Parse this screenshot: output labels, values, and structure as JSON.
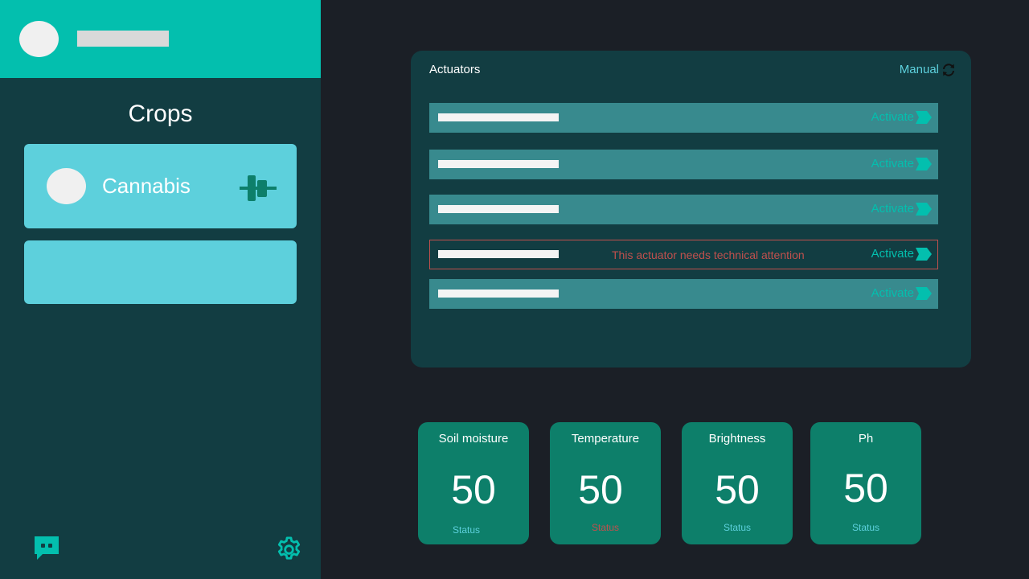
{
  "sidebar": {
    "title": "Crops",
    "crops": [
      {
        "name": "Cannabis",
        "icon": "plant-sensor-icon"
      }
    ],
    "footer": {
      "chat_icon": "chat-icon",
      "settings_icon": "gear-icon"
    }
  },
  "actuators": {
    "title": "Actuators",
    "mode_label": "Manual",
    "mode_icon": "sync-icon",
    "activate_label": "Activate",
    "alert_message": "This actuator needs technical attention",
    "alert_row_index": 4,
    "row_count": 5
  },
  "sensors": [
    {
      "name": "Soil moisture",
      "value": "50",
      "status": "Status",
      "status_state": "normal"
    },
    {
      "name": "Temperature",
      "value": "50",
      "status": "Status",
      "status_state": "warning"
    },
    {
      "name": "Brightness",
      "value": "50",
      "status": "Status",
      "status_state": "normal"
    },
    {
      "name": "Ph",
      "value": "50",
      "status": "Status",
      "status_state": "normal"
    }
  ],
  "colors": {
    "accent": "#03bfae",
    "panel": "#123d42",
    "card": "#5dd0dc",
    "row": "#388a8e",
    "sensor_card": "#0d7f6a",
    "alert": "#c0504d",
    "background": "#1b1f26"
  }
}
